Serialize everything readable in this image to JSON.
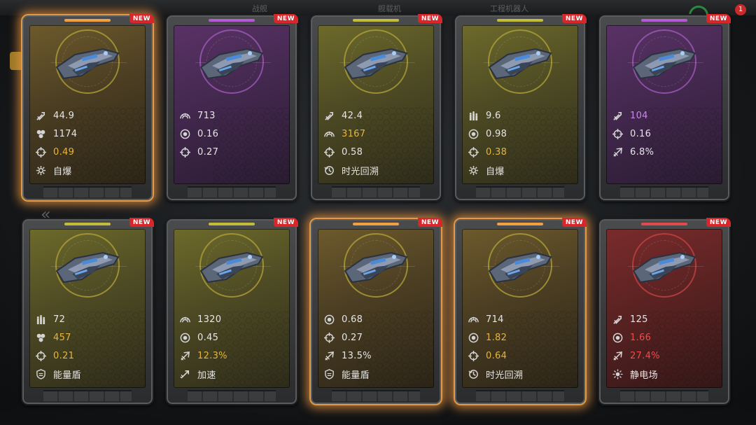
{
  "background": {
    "ghost_tabs": [
      "战舰",
      "舰载机",
      "工程机器人"
    ],
    "alert_count": "1"
  },
  "colors": {
    "yellow": "#8f8a2a",
    "purple": "#6b3a7a",
    "red": "#7a2828",
    "selected_glow": "#e09a48",
    "value_gold": "#e7b53d",
    "value_purple": "#c58ae8",
    "value_red": "#ee4c4c"
  },
  "cards": [
    {
      "theme": "yellow",
      "selected": true,
      "badge": "NEW",
      "stats": [
        {
          "icon": "attack-icon",
          "value": "44.9",
          "color": "white"
        },
        {
          "icon": "cluster-icon",
          "value": "1174",
          "color": "white"
        },
        {
          "icon": "crosshair-icon",
          "value": "0.49",
          "color": "gold"
        },
        {
          "icon": "gear-icon",
          "value": "自爆",
          "color": "white"
        }
      ]
    },
    {
      "theme": "purple",
      "selected": false,
      "badge": "NEW",
      "stats": [
        {
          "icon": "armor-icon",
          "value": "713",
          "color": "white"
        },
        {
          "icon": "shield-ring-icon",
          "value": "0.16",
          "color": "white"
        },
        {
          "icon": "crosshair-icon",
          "value": "0.27",
          "color": "white"
        }
      ]
    },
    {
      "theme": "yellow",
      "selected": false,
      "badge": "NEW",
      "stats": [
        {
          "icon": "attack-icon",
          "value": "42.4",
          "color": "white"
        },
        {
          "icon": "armor-icon",
          "value": "3167",
          "color": "gold"
        },
        {
          "icon": "crosshair-icon",
          "value": "0.58",
          "color": "white"
        },
        {
          "icon": "time-rewind-icon",
          "value": "时光回溯",
          "color": "white"
        }
      ]
    },
    {
      "theme": "yellow",
      "selected": false,
      "badge": "NEW",
      "stats": [
        {
          "icon": "ammo-icon",
          "value": "9.6",
          "color": "white"
        },
        {
          "icon": "shield-ring-icon",
          "value": "0.98",
          "color": "white"
        },
        {
          "icon": "crosshair-icon",
          "value": "0.38",
          "color": "gold"
        },
        {
          "icon": "gear-icon",
          "value": "自爆",
          "color": "white"
        }
      ]
    },
    {
      "theme": "purple",
      "selected": false,
      "badge": "NEW",
      "stats": [
        {
          "icon": "attack-icon",
          "value": "104",
          "color": "purple"
        },
        {
          "icon": "crosshair-icon",
          "value": "0.16",
          "color": "white"
        },
        {
          "icon": "boost-icon",
          "value": "6.8%",
          "color": "white"
        }
      ]
    },
    {
      "theme": "yellow",
      "selected": false,
      "badge": "NEW",
      "stats": [
        {
          "icon": "ammo-icon",
          "value": "72",
          "color": "white"
        },
        {
          "icon": "cluster-icon",
          "value": "457",
          "color": "gold"
        },
        {
          "icon": "crosshair-icon",
          "value": "0.21",
          "color": "gold"
        },
        {
          "icon": "energy-shield-icon",
          "value": "能量盾",
          "color": "white"
        }
      ]
    },
    {
      "theme": "yellow",
      "selected": false,
      "badge": "NEW",
      "stats": [
        {
          "icon": "armor-icon",
          "value": "1320",
          "color": "white"
        },
        {
          "icon": "shield-ring-icon",
          "value": "0.45",
          "color": "white"
        },
        {
          "icon": "boost-icon",
          "value": "12.3%",
          "color": "gold"
        },
        {
          "icon": "speed-icon",
          "value": "加速",
          "color": "white"
        }
      ]
    },
    {
      "theme": "yellow",
      "selected": true,
      "badge": "NEW",
      "stats": [
        {
          "icon": "shield-ring-icon",
          "value": "0.68",
          "color": "white"
        },
        {
          "icon": "crosshair-icon",
          "value": "0.27",
          "color": "white"
        },
        {
          "icon": "boost-icon",
          "value": "13.5%",
          "color": "white"
        },
        {
          "icon": "energy-shield-icon",
          "value": "能量盾",
          "color": "white"
        }
      ]
    },
    {
      "theme": "yellow",
      "selected": true,
      "badge": "NEW",
      "stats": [
        {
          "icon": "armor-icon",
          "value": "714",
          "color": "white"
        },
        {
          "icon": "shield-ring-icon",
          "value": "1.82",
          "color": "gold"
        },
        {
          "icon": "crosshair-icon",
          "value": "0.64",
          "color": "gold"
        },
        {
          "icon": "time-rewind-icon",
          "value": "时光回溯",
          "color": "white"
        }
      ]
    },
    {
      "theme": "red",
      "selected": false,
      "badge": "NEW",
      "stats": [
        {
          "icon": "attack-icon",
          "value": "125",
          "color": "white"
        },
        {
          "icon": "shield-ring-icon",
          "value": "1.66",
          "color": "red"
        },
        {
          "icon": "boost-icon",
          "value": "27.4%",
          "color": "red"
        },
        {
          "icon": "static-field-icon",
          "value": "静电场",
          "color": "white"
        }
      ]
    }
  ]
}
